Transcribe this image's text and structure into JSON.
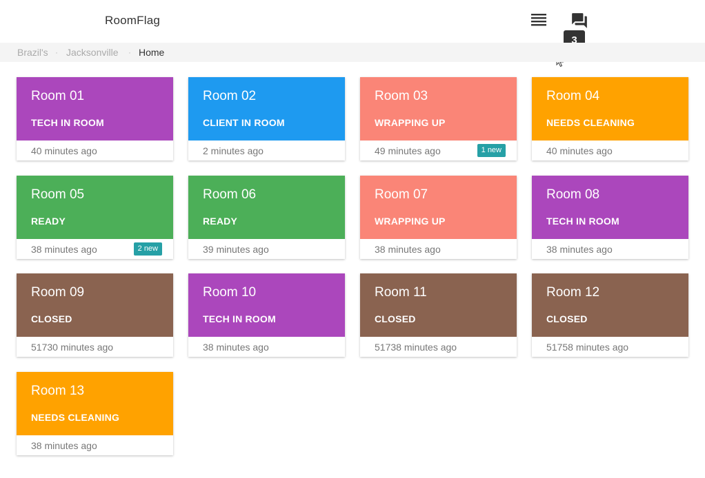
{
  "header": {
    "app_title": "RoomFlag",
    "menu_icon": "list-icon",
    "chat_icon": "forum-icon",
    "chat_badge": "3"
  },
  "breadcrumb": {
    "items": [
      "Brazil's",
      "Jacksonville",
      "Home"
    ],
    "separator": "·"
  },
  "status_colors": {
    "TECH IN ROOM": "#ab47bc",
    "CLIENT IN ROOM": "#1e9af0",
    "WRAPPING UP": "#fa8577",
    "NEEDS CLEANING": "#ffa200",
    "READY": "#4caf58",
    "CLOSED": "#8a6350"
  },
  "rooms": [
    {
      "name": "Room 01",
      "status": "TECH IN ROOM",
      "time": "40 minutes ago",
      "badge": ""
    },
    {
      "name": "Room 02",
      "status": "CLIENT IN ROOM",
      "time": "2 minutes ago",
      "badge": ""
    },
    {
      "name": "Room 03",
      "status": "WRAPPING UP",
      "time": "49 minutes ago",
      "badge": "1 new"
    },
    {
      "name": "Room 04",
      "status": "NEEDS CLEANING",
      "time": "40 minutes ago",
      "badge": ""
    },
    {
      "name": "Room 05",
      "status": "READY",
      "time": "38 minutes ago",
      "badge": "2 new"
    },
    {
      "name": "Room 06",
      "status": "READY",
      "time": "39 minutes ago",
      "badge": ""
    },
    {
      "name": "Room 07",
      "status": "WRAPPING UP",
      "time": "38 minutes ago",
      "badge": ""
    },
    {
      "name": "Room 08",
      "status": "TECH IN ROOM",
      "time": "38 minutes ago",
      "badge": ""
    },
    {
      "name": "Room 09",
      "status": "CLOSED",
      "time": "51730 minutes ago",
      "badge": ""
    },
    {
      "name": "Room 10",
      "status": "TECH IN ROOM",
      "time": "38 minutes ago",
      "badge": ""
    },
    {
      "name": "Room 11",
      "status": "CLOSED",
      "time": "51738 minutes ago",
      "badge": ""
    },
    {
      "name": "Room 12",
      "status": "CLOSED",
      "time": "51758 minutes ago",
      "badge": ""
    },
    {
      "name": "Room 13",
      "status": "NEEDS CLEANING",
      "time": "38 minutes ago",
      "badge": ""
    }
  ]
}
